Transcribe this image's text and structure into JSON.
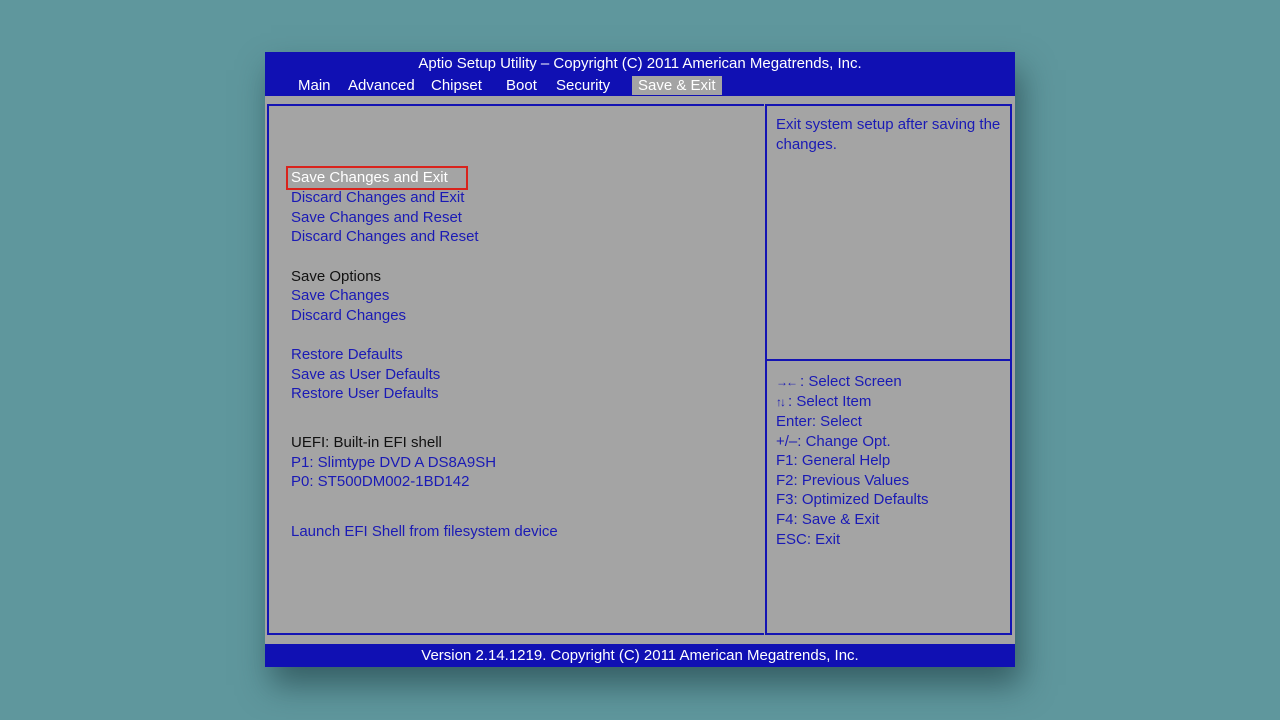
{
  "header": {
    "title": "Aptio Setup Utility – Copyright (C) 2011 American Megatrends, Inc.",
    "tabs": [
      "Main",
      "Advanced",
      "Chipset",
      "Boot",
      "Security",
      "Save & Exit"
    ],
    "active_tab": "Save & Exit"
  },
  "menu": {
    "save_changes_exit": "Save Changes and Exit",
    "discard_changes_exit": "Discard Changes and Exit",
    "save_changes_reset": "Save Changes and Reset",
    "discard_changes_reset": "Discard Changes and Reset",
    "save_options_label": "Save Options",
    "save_changes": "Save Changes",
    "discard_changes": "Discard Changes",
    "restore_defaults": "Restore Defaults",
    "save_user_defaults": "Save as User Defaults",
    "restore_user_defaults": "Restore User Defaults",
    "boot_override_label": "UEFI: Built-in EFI shell",
    "boot_p1": "P1: Slimtype DVD A DS8A9SH",
    "boot_p0": "P0: ST500DM002-1BD142",
    "launch_efi_shell": "Launch EFI Shell from filesystem device",
    "selected_item": "Save Changes and Exit"
  },
  "help": {
    "text": "Exit system setup after saving the changes."
  },
  "keys": {
    "select_screen_icon": "→←",
    "select_screen": ": Select Screen",
    "select_item_icon": "↑↓",
    "select_item": ": Select Item",
    "enter": "Enter: Select",
    "change_opt": "+/–: Change Opt.",
    "f1": "F1: General Help",
    "f2": "F2: Previous Values",
    "f3": "F3: Optimized Defaults",
    "f4": "F4: Save & Exit",
    "esc": "ESC: Exit"
  },
  "footer": {
    "text": "Version 2.14.1219. Copyright (C) 2011 American Megatrends, Inc."
  },
  "colors": {
    "background": "#5f979d",
    "bios_blue": "#1010b3",
    "panel_gray": "#a4a4a4",
    "item_text": "#1a1ab5",
    "selection_outline": "#d9231c"
  }
}
